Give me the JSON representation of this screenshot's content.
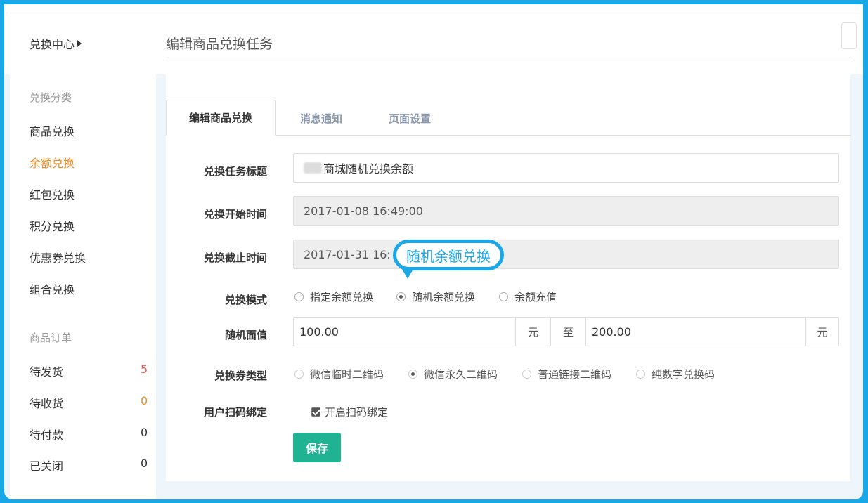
{
  "header": {
    "center_label": "兑换中心",
    "page_title": "编辑商品兑换任务"
  },
  "sidebar": {
    "group_exchange": "兑换分类",
    "items": [
      {
        "label": "商品兑换"
      },
      {
        "label": "余额兑换"
      },
      {
        "label": "红包兑换"
      },
      {
        "label": "积分兑换"
      },
      {
        "label": "优惠券兑换"
      },
      {
        "label": "组合兑换"
      }
    ],
    "group_orders": "商品订单",
    "orders": [
      {
        "label": "待发货",
        "count": "5",
        "color": "#e8554e"
      },
      {
        "label": "待收货",
        "count": "0",
        "color": "#f08c28"
      },
      {
        "label": "待付款",
        "count": "0",
        "color": "#333333"
      },
      {
        "label": "已关闭",
        "count": "0",
        "color": "#333333"
      }
    ]
  },
  "tabs": [
    {
      "label": "编辑商品兑换"
    },
    {
      "label": "消息通知"
    },
    {
      "label": "页面设置"
    }
  ],
  "form": {
    "title_label": "兑换任务标题",
    "title_value": "商城随机兑换余额",
    "start_label": "兑换开始时间",
    "start_value": "2017-01-08 16:49:00",
    "end_label": "兑换截止时间",
    "end_value": "2017-01-31 16:",
    "mode_label": "兑换模式",
    "mode_options": [
      "指定余额兑换",
      "随机余额兑换",
      "余额充值"
    ],
    "random_label": "随机面值",
    "random_min": "100.00",
    "unit": "元",
    "to": "至",
    "random_max": "200.00",
    "coupon_label": "兑换券类型",
    "coupon_options": [
      "微信临时二维码",
      "微信永久二维码",
      "普通链接二维码",
      "纯数字兑换码"
    ],
    "bind_label": "用户扫码绑定",
    "bind_checkbox": "开启扫码绑定",
    "save": "保存"
  },
  "callout": {
    "text": "随机余额兑换"
  },
  "colors": {
    "frame": "#1aa7e8",
    "active_sidebar": "#f08c28",
    "save_button": "#1fb394"
  }
}
